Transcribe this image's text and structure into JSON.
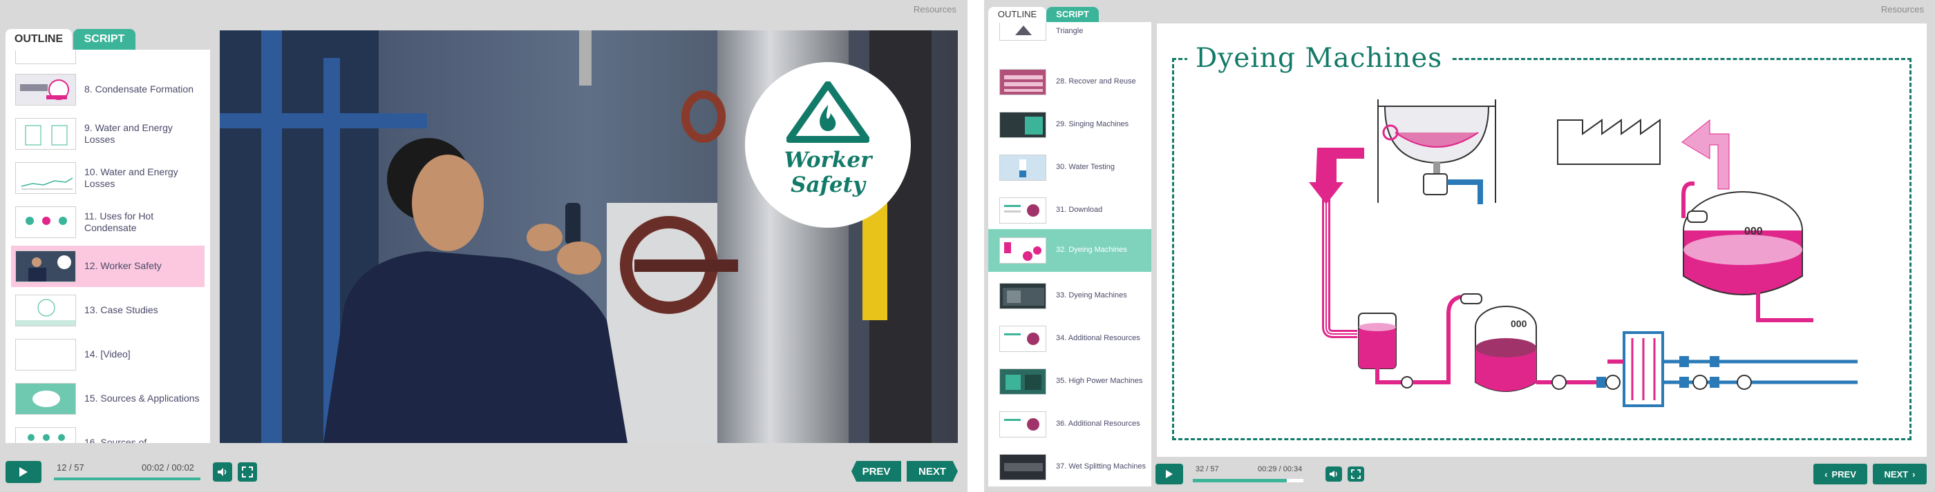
{
  "left_player": {
    "resources_label": "Resources",
    "tabs": {
      "outline": "OUTLINE",
      "script": "SCRIPT"
    },
    "outline_items": [
      {
        "label": "8. Condensate Formation",
        "active": false
      },
      {
        "label": "9. Water and Energy Losses",
        "active": false
      },
      {
        "label": "10. Water and Energy Losses",
        "active": false
      },
      {
        "label": "11. Uses for Hot Condensate",
        "active": false
      },
      {
        "label": "12. Worker Safety",
        "active": true
      },
      {
        "label": "13. Case Studies",
        "active": false
      },
      {
        "label": "14. [Video]",
        "active": false
      },
      {
        "label": "15. Sources & Applications",
        "active": false
      },
      {
        "label": "16. Sources of",
        "active": false
      }
    ],
    "slide": {
      "badge_line1": "Worker",
      "badge_line2": "Safety"
    },
    "controls": {
      "slide_counter": "12 / 57",
      "time": "00:02 / 00:02",
      "progress": 1.0,
      "prev": "PREV",
      "next": "NEXT"
    }
  },
  "right_player": {
    "resources_label": "Resources",
    "tabs": {
      "outline": "OUTLINE",
      "script": "SCRIPT"
    },
    "outline_items": [
      {
        "label": "Triangle",
        "active": false
      },
      {
        "label": "28. Recover and Reuse",
        "active": false
      },
      {
        "label": "29. Singing Machines",
        "active": false
      },
      {
        "label": "30. Water Testing",
        "active": false
      },
      {
        "label": "31. Download",
        "active": false
      },
      {
        "label": "32. Dyeing Machines",
        "active": true
      },
      {
        "label": "33. Dyeing Machines",
        "active": false
      },
      {
        "label": "34. Additional Resources",
        "active": false
      },
      {
        "label": "35. High Power Machines",
        "active": false
      },
      {
        "label": "36. Additional Resources",
        "active": false
      },
      {
        "label": "37. Wet Splitting Machines",
        "active": false
      }
    ],
    "slide": {
      "title": "Dyeing Machines",
      "tank_label_1": "000",
      "tank_label_2": "000"
    },
    "controls": {
      "slide_counter": "32 / 57",
      "time": "00:29 / 00:34",
      "progress": 0.85,
      "prev": "PREV",
      "next": "NEXT"
    }
  },
  "colors": {
    "accent": "#3bb49a",
    "button": "#127a68",
    "active_left": "#fbc8df",
    "active_right": "#7fd3bd",
    "magenta": "#e0268a",
    "blue": "#2a7ab8"
  }
}
